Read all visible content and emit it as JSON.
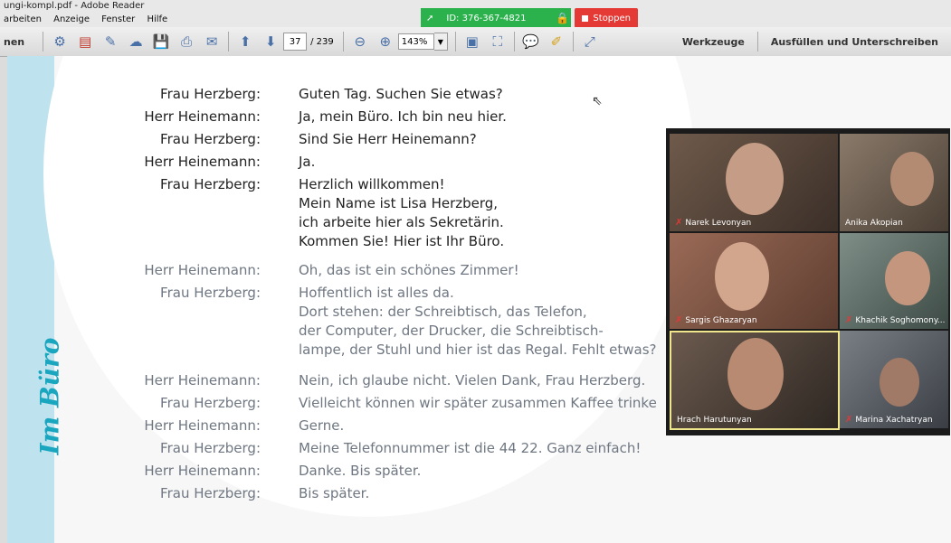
{
  "window": {
    "title": "ungi-kompl.pdf - Adobe Reader"
  },
  "menu": [
    "arbeiten",
    "Anzeige",
    "Fenster",
    "Hilfe"
  ],
  "toolbar_left_label": "nen",
  "sharing": {
    "id_label": "ID: 376-367-4821",
    "stop_label": "Stoppen"
  },
  "navigation": {
    "current_page": "37",
    "total_pages": "/ 239",
    "zoom": "143%"
  },
  "toolbar_right": {
    "tools_label": "Werkzeuge",
    "fill_sign_label": "Ausfüllen und Unterschreiben"
  },
  "document": {
    "side_title": "Im Büro",
    "dialogue": [
      {
        "speaker": "Frau Herzberg:",
        "lines": [
          "Guten Tag. Suchen Sie etwas?"
        ]
      },
      {
        "speaker": "Herr Heinemann:",
        "lines": [
          "Ja, mein Büro. Ich bin neu hier."
        ]
      },
      {
        "speaker": "Frau Herzberg:",
        "lines": [
          "Sind Sie Herr Heinemann?"
        ]
      },
      {
        "speaker": "Herr Heinemann:",
        "lines": [
          "Ja."
        ]
      },
      {
        "speaker": "Frau Herzberg:",
        "lines": [
          "Herzlich willkommen!",
          "Mein Name ist Lisa Herzberg,",
          "ich arbeite hier als Sekretärin.",
          "Kommen Sie! Hier ist Ihr Büro."
        ]
      },
      {
        "speaker": "Herr Heinemann:",
        "lines": [
          "Oh, das ist ein schönes Zimmer!"
        ]
      },
      {
        "speaker": "Frau Herzberg:",
        "lines": [
          "Hoffentlich ist alles da.",
          "Dort stehen: der Schreibtisch, das Telefon,",
          "der Computer, der Drucker, die Schreibtisch-",
          "lampe, der Stuhl und hier ist das Regal. Fehlt etwas?"
        ]
      },
      {
        "speaker": "Herr Heinemann:",
        "lines": [
          "Nein, ich glaube nicht. Vielen Dank, Frau Herzberg."
        ]
      },
      {
        "speaker": "Frau Herzberg:",
        "lines": [
          "Vielleicht können wir später zusammen Kaffee trinke"
        ]
      },
      {
        "speaker": "Herr Heinemann:",
        "lines": [
          "Gerne."
        ]
      },
      {
        "speaker": "Frau Herzberg:",
        "lines": [
          "Meine Telefonnummer ist die 44 22. Ganz einfach!"
        ]
      },
      {
        "speaker": "Herr Heinemann:",
        "lines": [
          "Danke. Bis später."
        ]
      },
      {
        "speaker": "Frau Herzberg:",
        "lines": [
          "Bis später."
        ]
      }
    ]
  },
  "participants": [
    {
      "name": "Narek Levonyan",
      "muted": true
    },
    {
      "name": "Anika Akopian",
      "muted": false
    },
    {
      "name": "Sargis Ghazaryan",
      "muted": true
    },
    {
      "name": "Khachik Soghomony...",
      "muted": true
    },
    {
      "name": "Hrach Harutunyan",
      "muted": false
    },
    {
      "name": "Marina Xachatryan",
      "muted": true
    }
  ],
  "colors": {
    "accent_teal": "#1aa6bf",
    "share_green": "#2bb24c",
    "stop_red": "#e53935"
  }
}
